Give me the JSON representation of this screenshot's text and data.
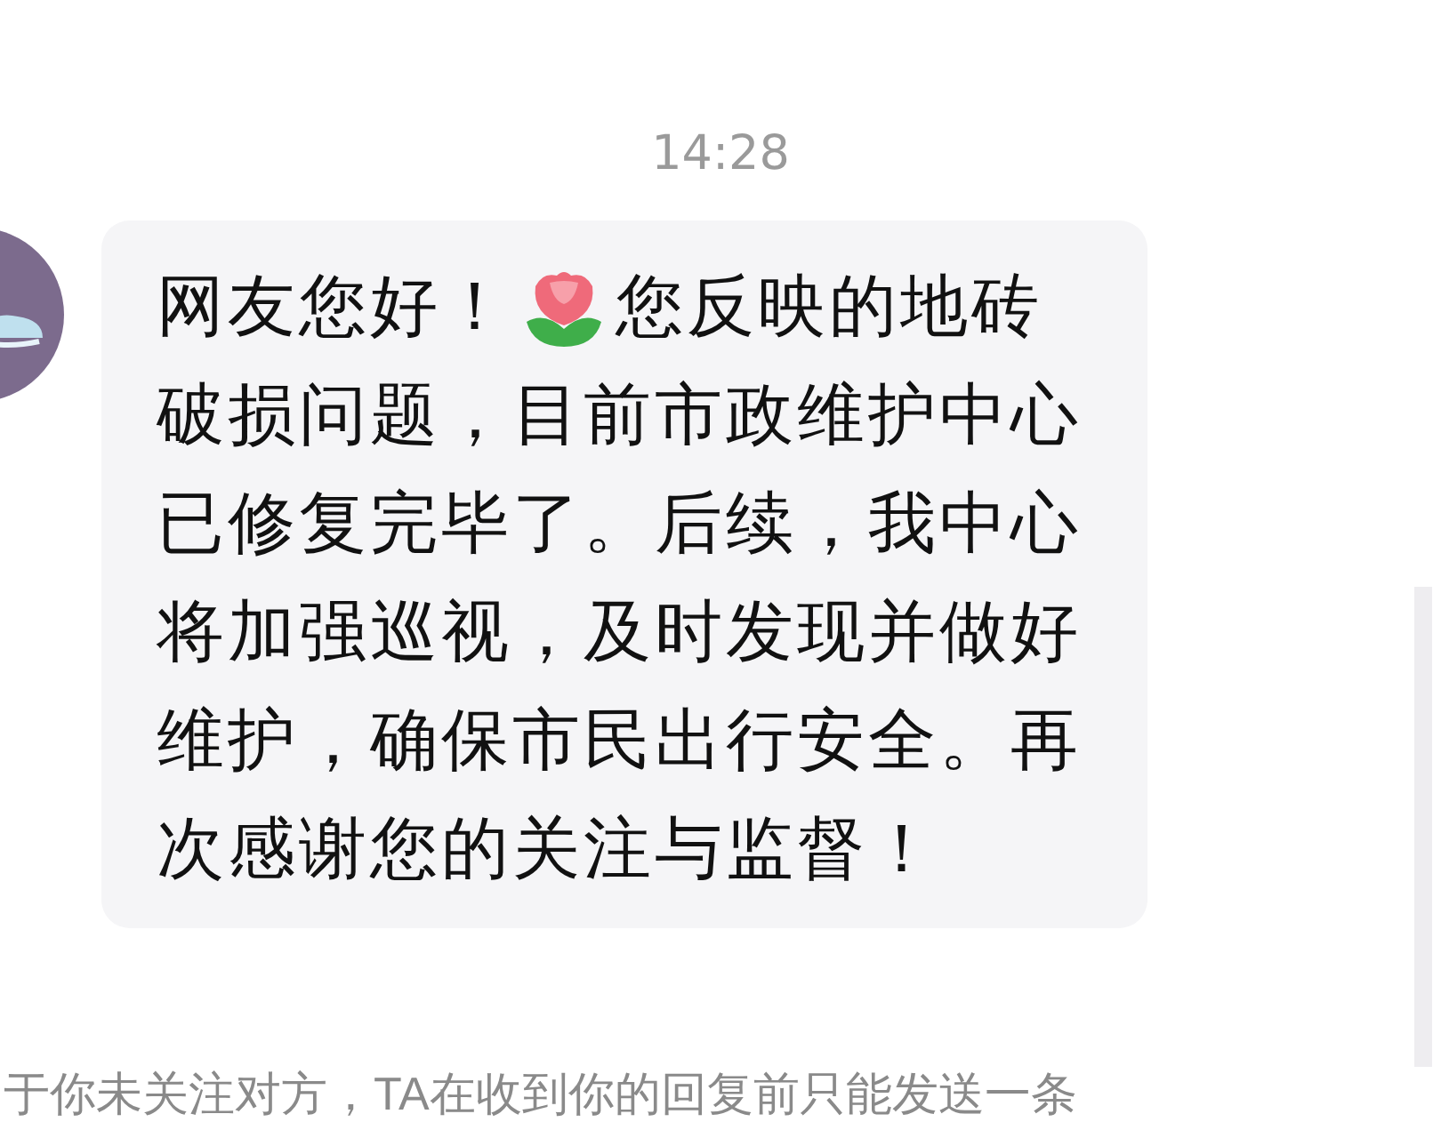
{
  "timestamp": "14:28",
  "message": {
    "text_before_emoji": "网友您好！",
    "text_after_emoji": "您反映的地砖",
    "lines": [
      "破损问题，目前市政维护中心",
      "已修复完毕了。后续，我中心",
      "将加强巡视，及时发现并做好",
      "维护，确保市民出行安全。再",
      "次感谢您的关注与监督！"
    ]
  },
  "notice": "于你未关注对方，TA在收到你的回复前只能发送一条"
}
